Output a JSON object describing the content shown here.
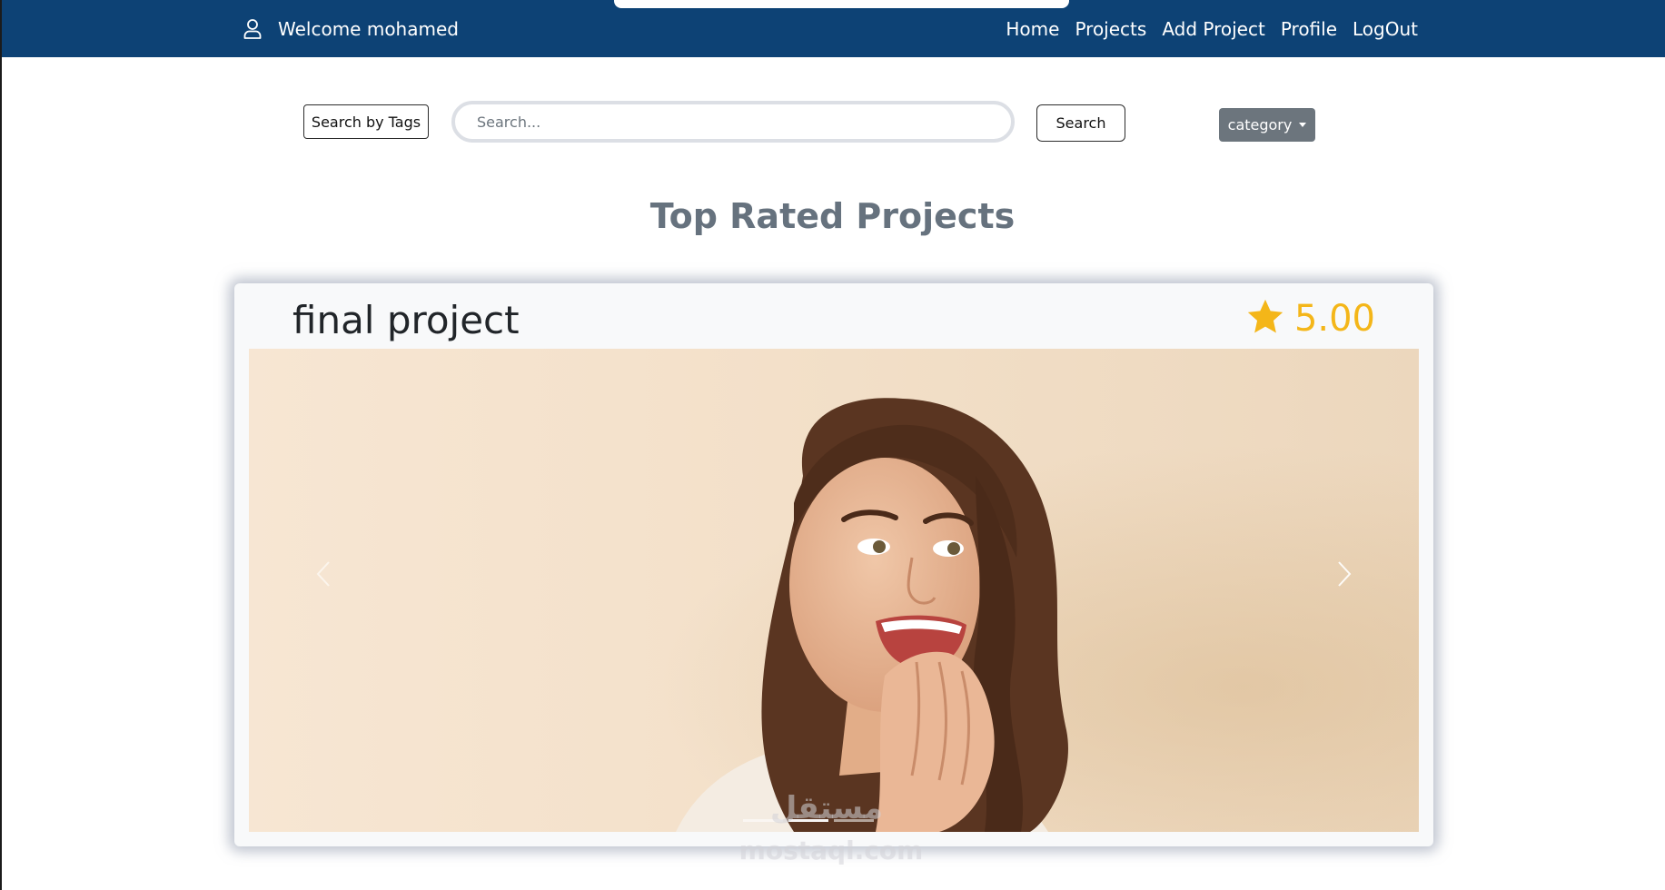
{
  "navbar": {
    "welcome": "Welcome mohamed",
    "links": [
      "Home",
      "Projects",
      "Add Project",
      "Profile",
      "LogOut"
    ]
  },
  "search": {
    "tags_label": "Search by Tags",
    "placeholder": "Search...",
    "button_label": "Search",
    "category_label": "category"
  },
  "main": {
    "section_title": "Top Rated Projects",
    "card": {
      "title": "final project",
      "rating": "5.00"
    }
  },
  "watermark": {
    "text": "مستقل",
    "sub": "mostaql.com"
  },
  "colors": {
    "navbar": "#0d4275",
    "rating": "#f4b619",
    "category_button": "#6c757d",
    "heading": "#66727e"
  },
  "carousel": {
    "slides": 3,
    "active_slide": 2
  }
}
